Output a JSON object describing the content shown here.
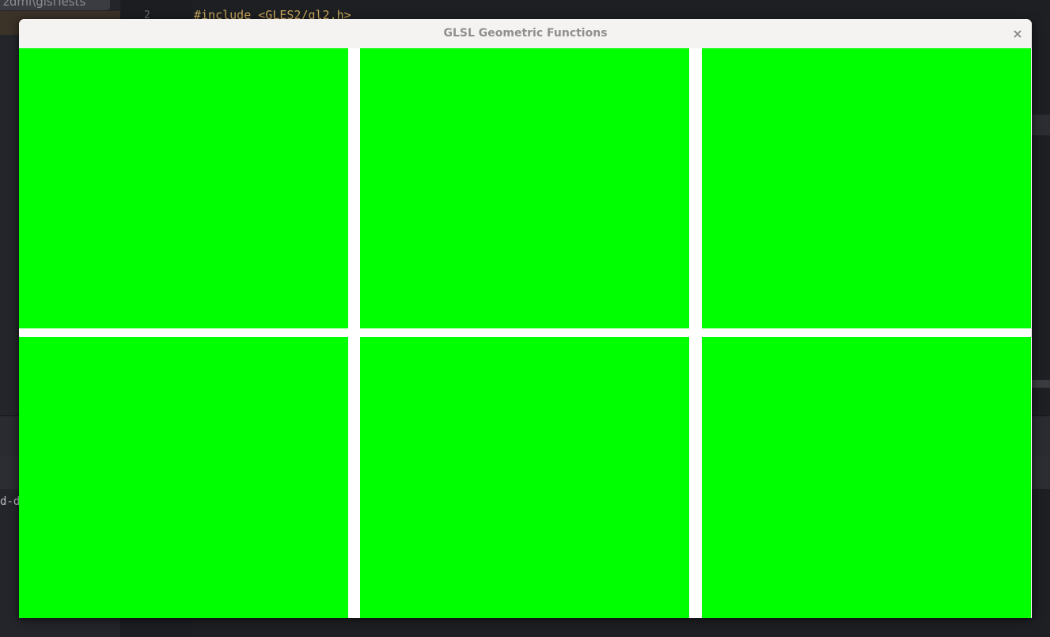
{
  "background": {
    "sidebar_tab": "zdmi\\glslTests",
    "line_number": "2",
    "code_line": "#include <GLES2/gl2.h>",
    "terminal_text": "d-d"
  },
  "window": {
    "title": "GLSL Geometric Functions",
    "close_label": "×",
    "cell_color": "#00ff00",
    "cells": [
      "",
      "",
      "",
      "",
      "",
      ""
    ]
  }
}
